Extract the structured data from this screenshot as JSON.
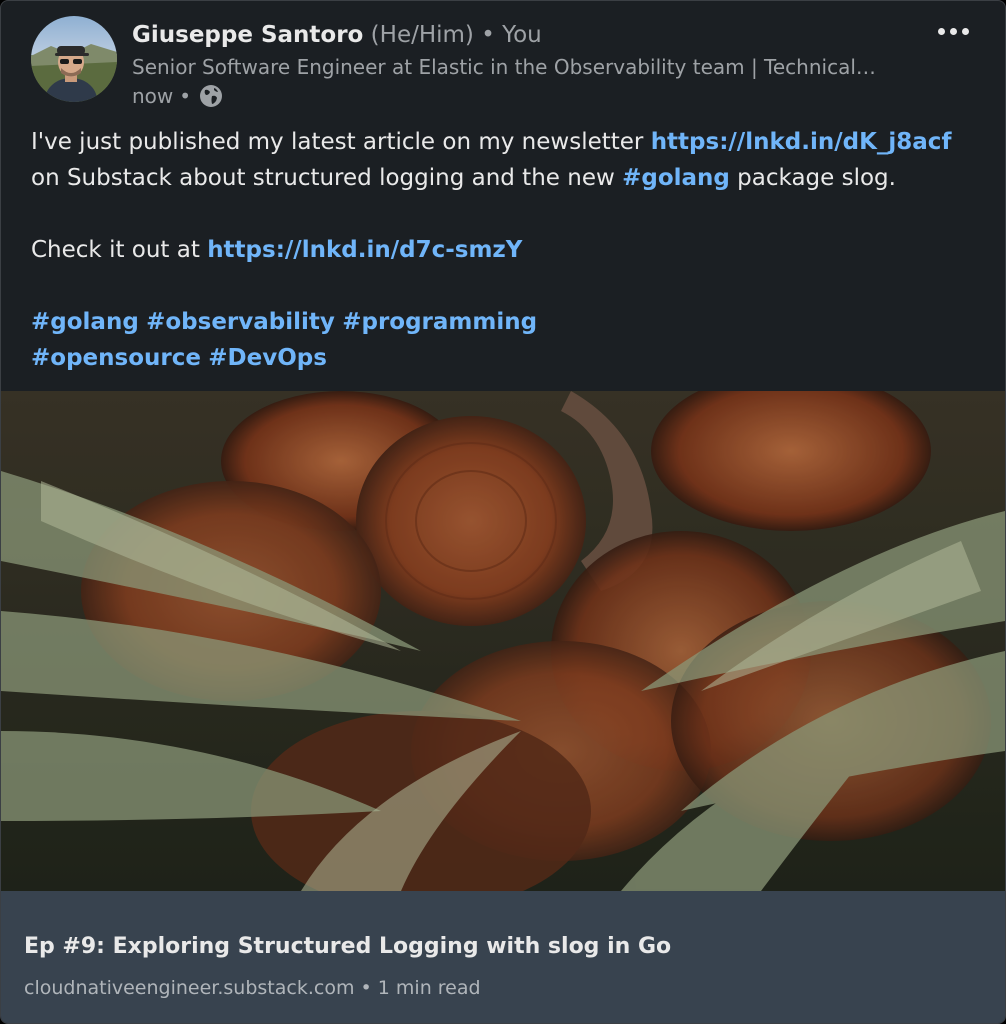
{
  "post": {
    "author": {
      "name": "Giuseppe Santoro",
      "pronouns": "(He/Him)",
      "separator": "•",
      "relation": "You",
      "headline": "Senior Software Engineer at Elastic in the Observability team | Technical wr…"
    },
    "time": "now",
    "time_separator": "•",
    "visibility_icon": "globe-icon",
    "more_icon": "more-options-icon",
    "body": {
      "p1_before": "I've just published my latest article on my newsletter ",
      "p1_link": "https://lnkd.in/dK_j8acf",
      "p1_after_link": " on Substack about structured logging and the new ",
      "p1_hashtag": "#golang",
      "p1_end": " package slog.",
      "p2_before": "Check it out at ",
      "p2_link": "https://lnkd.in/d7c-smzY",
      "tags_line1": [
        "#golang",
        "#observability",
        "#programming"
      ],
      "tags_line2": [
        "#opensource",
        "#DevOps"
      ]
    },
    "link_preview": {
      "title": "Ep #9: Exploring Structured Logging with slog in Go",
      "domain": "cloudnativeengineer.substack.com",
      "separator": "•",
      "read_time": "1 min read"
    }
  },
  "colors": {
    "card_background": "#1b1f23",
    "link": "#70b5f9",
    "primary_text": "#e9e9e9",
    "secondary_text": "#9ea2a6",
    "preview_background": "#38434f"
  }
}
